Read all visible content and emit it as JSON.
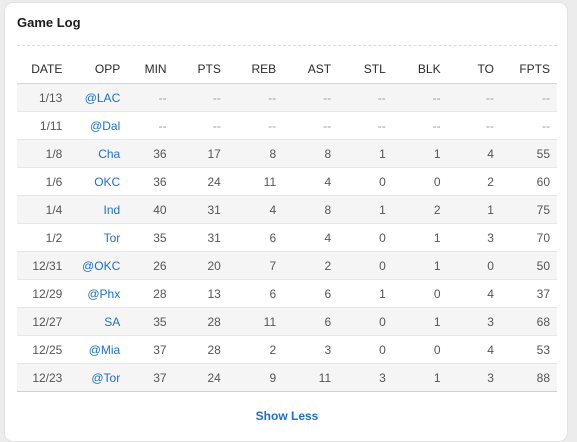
{
  "game_log": {
    "title": "Game Log",
    "columns": [
      "DATE",
      "OPP",
      "MIN",
      "PTS",
      "REB",
      "AST",
      "STL",
      "BLK",
      "TO",
      "FPTS"
    ],
    "rows": [
      {
        "date": "1/13",
        "opp": "@LAC",
        "min": "--",
        "pts": "--",
        "reb": "--",
        "ast": "--",
        "stl": "--",
        "blk": "--",
        "to": "--",
        "fpts": "--"
      },
      {
        "date": "1/11",
        "opp": "@Dal",
        "min": "--",
        "pts": "--",
        "reb": "--",
        "ast": "--",
        "stl": "--",
        "blk": "--",
        "to": "--",
        "fpts": "--"
      },
      {
        "date": "1/8",
        "opp": "Cha",
        "min": "36",
        "pts": "17",
        "reb": "8",
        "ast": "8",
        "stl": "1",
        "blk": "1",
        "to": "4",
        "fpts": "55"
      },
      {
        "date": "1/6",
        "opp": "OKC",
        "min": "36",
        "pts": "24",
        "reb": "11",
        "ast": "4",
        "stl": "0",
        "blk": "0",
        "to": "2",
        "fpts": "60"
      },
      {
        "date": "1/4",
        "opp": "Ind",
        "min": "40",
        "pts": "31",
        "reb": "4",
        "ast": "8",
        "stl": "1",
        "blk": "2",
        "to": "1",
        "fpts": "75"
      },
      {
        "date": "1/2",
        "opp": "Tor",
        "min": "35",
        "pts": "31",
        "reb": "6",
        "ast": "4",
        "stl": "0",
        "blk": "1",
        "to": "3",
        "fpts": "70"
      },
      {
        "date": "12/31",
        "opp": "@OKC",
        "min": "26",
        "pts": "20",
        "reb": "7",
        "ast": "2",
        "stl": "0",
        "blk": "1",
        "to": "0",
        "fpts": "50"
      },
      {
        "date": "12/29",
        "opp": "@Phx",
        "min": "28",
        "pts": "13",
        "reb": "6",
        "ast": "6",
        "stl": "1",
        "blk": "0",
        "to": "4",
        "fpts": "37"
      },
      {
        "date": "12/27",
        "opp": "SA",
        "min": "35",
        "pts": "28",
        "reb": "11",
        "ast": "6",
        "stl": "0",
        "blk": "1",
        "to": "3",
        "fpts": "68"
      },
      {
        "date": "12/25",
        "opp": "@Mia",
        "min": "37",
        "pts": "28",
        "reb": "2",
        "ast": "3",
        "stl": "0",
        "blk": "0",
        "to": "4",
        "fpts": "53"
      },
      {
        "date": "12/23",
        "opp": "@Tor",
        "min": "37",
        "pts": "24",
        "reb": "9",
        "ast": "11",
        "stl": "3",
        "blk": "1",
        "to": "3",
        "fpts": "88"
      }
    ],
    "show_less_label": "Show Less"
  },
  "colors": {
    "link": "#1f6fc5",
    "stripe": "#f5f5f5",
    "text": "#555555",
    "header_text": "#2a2a2a"
  }
}
